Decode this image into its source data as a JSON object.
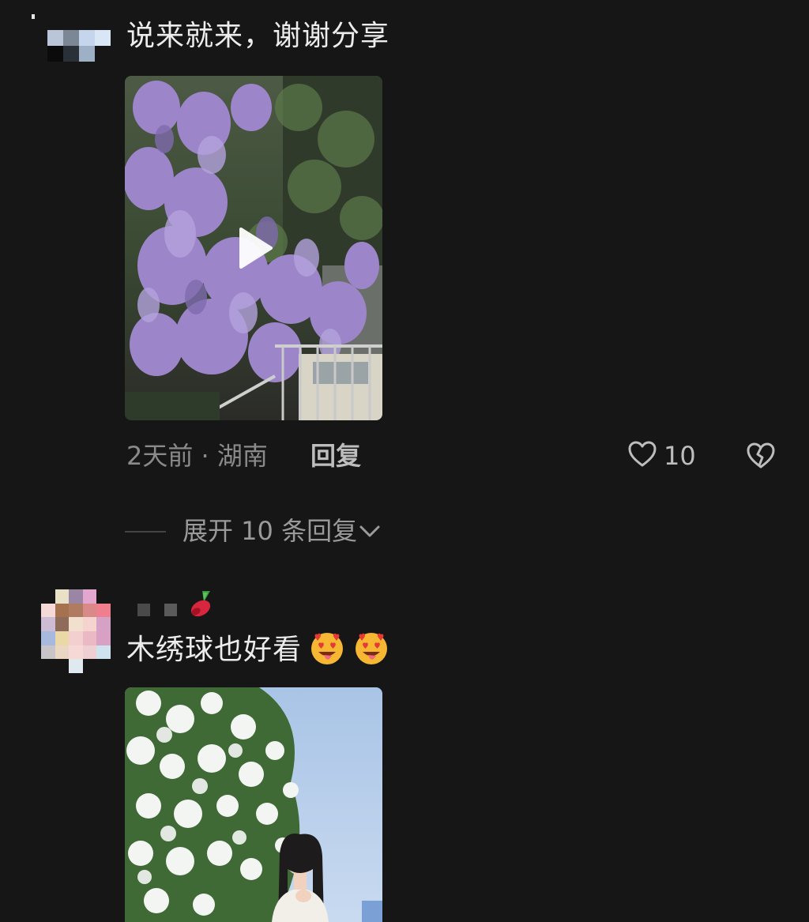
{
  "comments": [
    {
      "text": "说来就来，谢谢分享",
      "media": {
        "type": "video",
        "icon": "play-icon"
      },
      "meta": {
        "time_location": "2天前 · 湖南",
        "reply_label": "回复",
        "like_count": "10"
      },
      "expand_replies_label": "展开 10 条回复"
    },
    {
      "text": "木绣球也好看",
      "emojis": [
        "star-struck-tongue-emoji",
        "star-struck-tongue-emoji"
      ],
      "username_icon": "cherry-icon",
      "media": {
        "type": "image"
      }
    }
  ],
  "colors": {
    "background": "#161616",
    "text_primary": "#ececec",
    "text_secondary": "#8a8a8a",
    "emoji_face": "#f7b733",
    "emoji_heart": "#e53935"
  }
}
